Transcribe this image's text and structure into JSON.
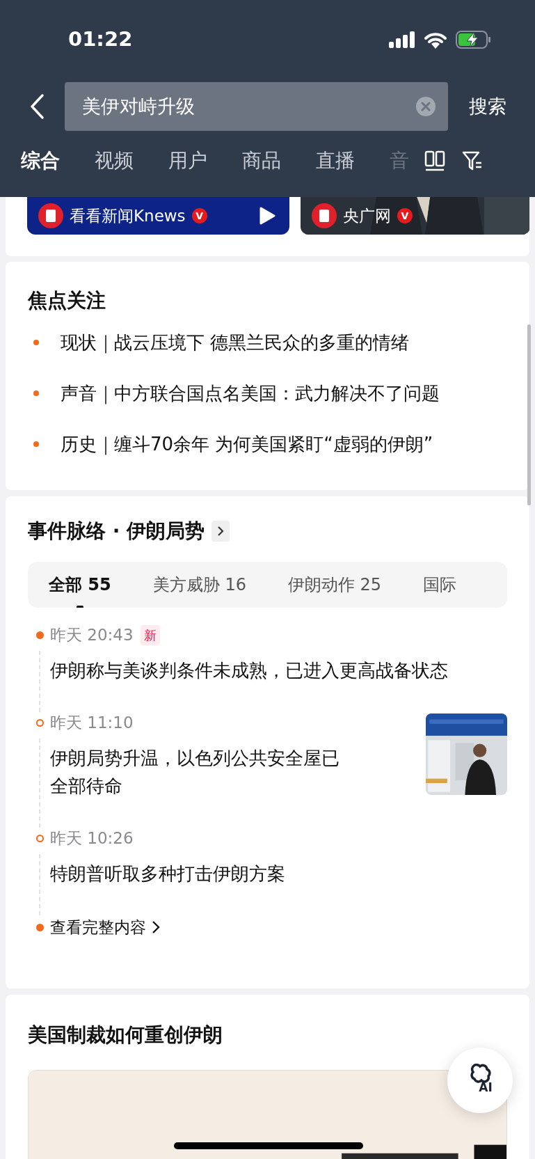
{
  "status_bar": {
    "time": "01:22"
  },
  "search": {
    "value": "美伊对峙升级",
    "action": "搜索"
  },
  "tabs": [
    {
      "label": "综合",
      "selected": true
    },
    {
      "label": "视频",
      "selected": false
    },
    {
      "label": "用户",
      "selected": false
    },
    {
      "label": "商品",
      "selected": false
    },
    {
      "label": "直播",
      "selected": false
    },
    {
      "label": "音",
      "selected": false
    }
  ],
  "account_cards": [
    {
      "name": "看看新闻Knews",
      "badge": "V",
      "kind": "video"
    },
    {
      "name": "央广网",
      "badge": "V",
      "kind": "picture"
    }
  ],
  "focus": {
    "title": "焦点关注",
    "items": [
      {
        "text": "现状｜战云压境下 德黑兰民众的多重的情绪"
      },
      {
        "text": "声音｜中方联合国点名美国：武力解决不了问题"
      },
      {
        "text": "历史｜缠斗70余年 为何美国紧盯“虚弱的伊朗”"
      }
    ]
  },
  "timeline": {
    "title": "事件脉络 · 伊朗局势",
    "filters": [
      {
        "label": "全部 55",
        "selected": true
      },
      {
        "label": "美方威胁 16",
        "selected": false
      },
      {
        "label": "伊朗动作 25",
        "selected": false
      },
      {
        "label": "国际",
        "selected": false
      }
    ],
    "events": [
      {
        "time": "昨天 20:43",
        "tag": "新",
        "text": "伊朗称与美谈判条件未成熟，已进入更高战备状态",
        "highlighted": true,
        "thumbnail": false
      },
      {
        "time": "昨天 11:10",
        "text": "伊朗局势升温，以色列公共安全屋已全部待命",
        "highlighted": false,
        "thumbnail": true
      },
      {
        "time": "昨天 10:26",
        "text": "特朗普听取多种打击伊朗方案",
        "highlighted": false,
        "thumbnail": false
      }
    ],
    "more": "查看完整内容"
  },
  "sanctions": {
    "title": "美国制裁如何重创伊朗"
  },
  "ai_button": {
    "label": "AI"
  }
}
